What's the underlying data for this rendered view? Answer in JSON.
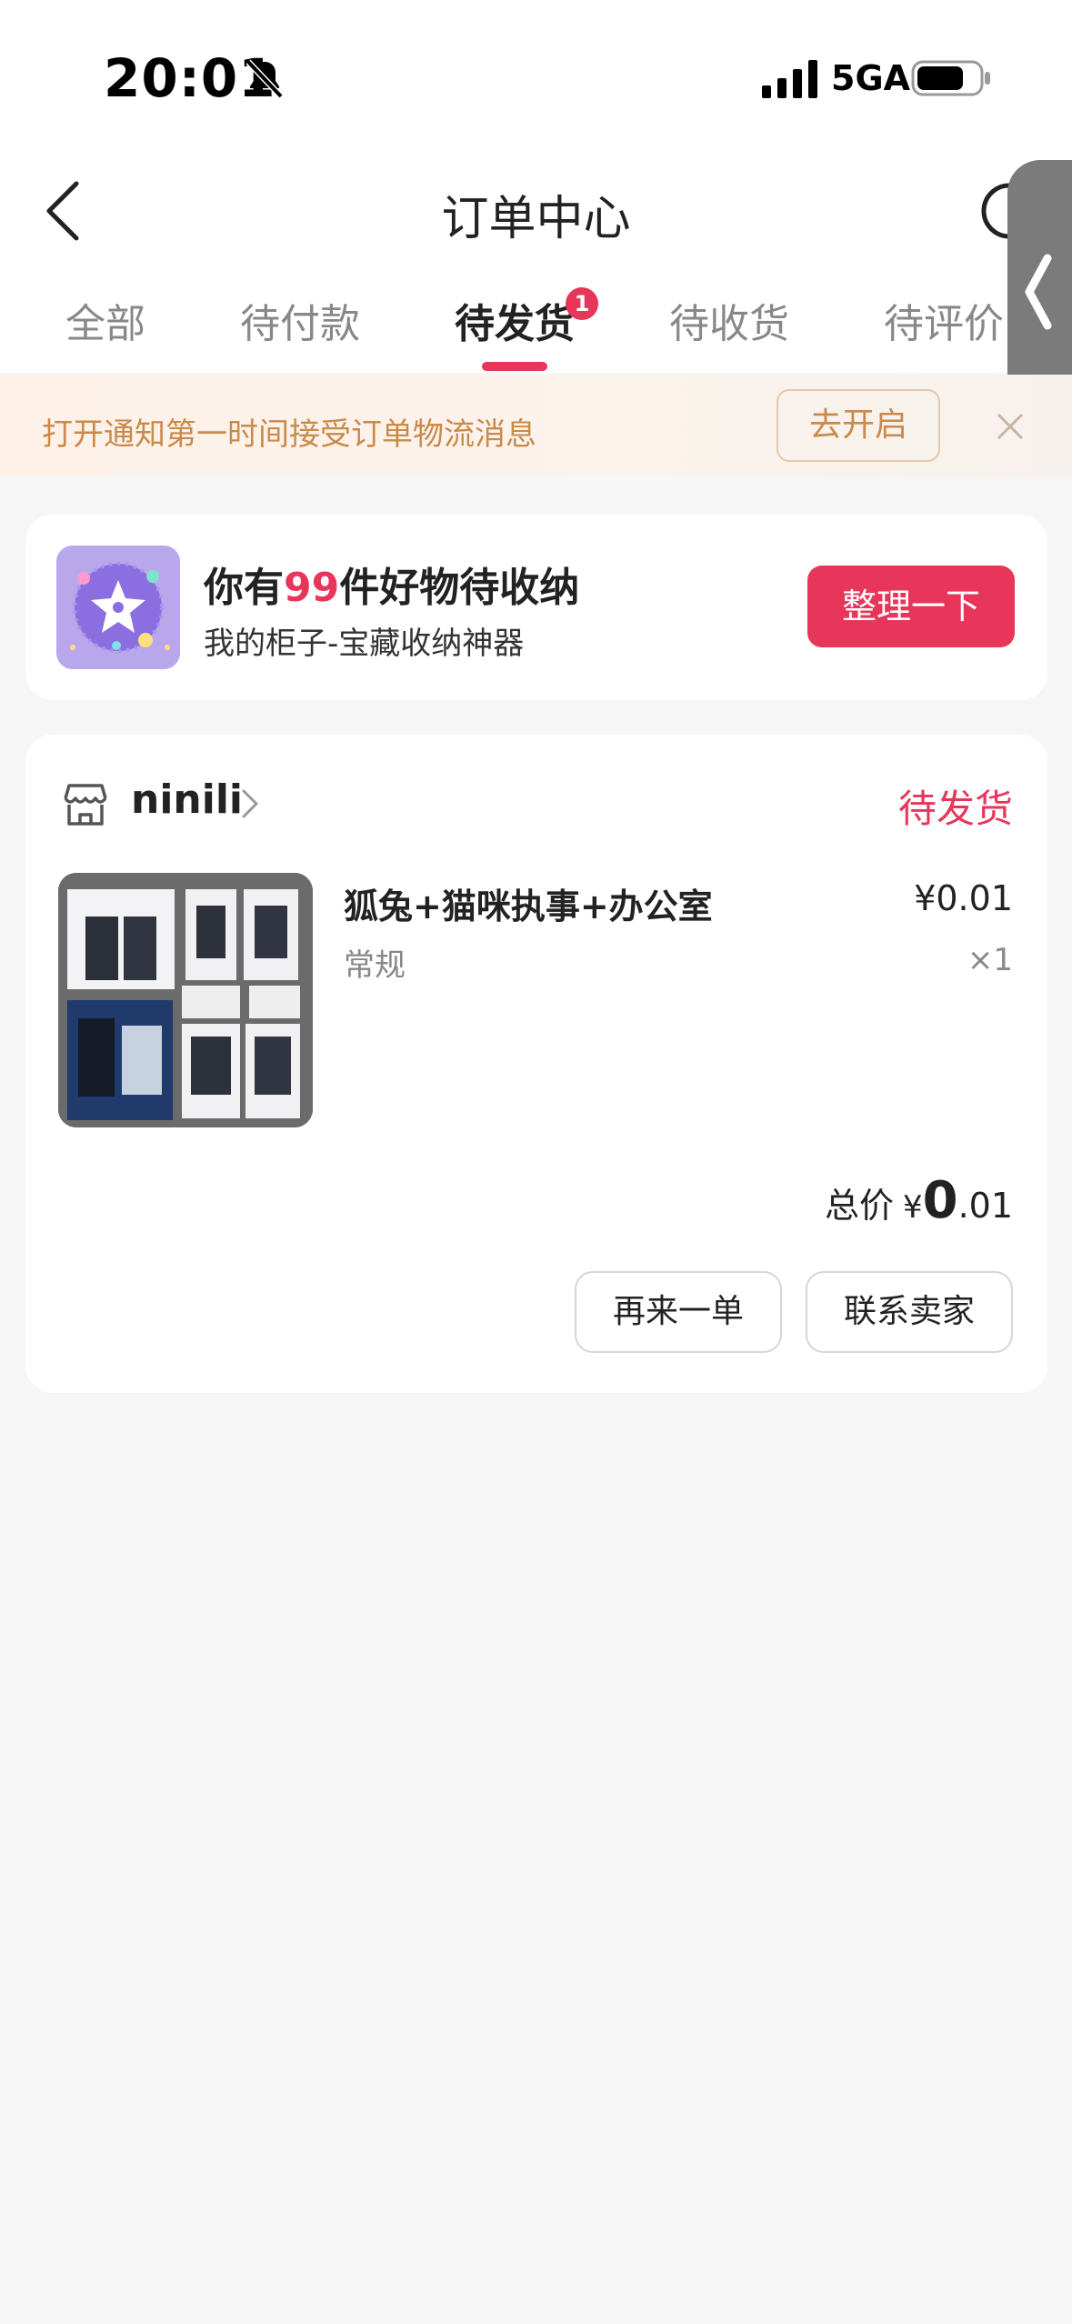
{
  "status_bar": {
    "time": "20:01",
    "network": "5GA",
    "icons": [
      "bell-off-icon",
      "signal-icon",
      "battery-icon"
    ]
  },
  "header": {
    "title": "订单中心",
    "tabs": [
      {
        "label": "全部",
        "active": false
      },
      {
        "label": "待付款",
        "active": false
      },
      {
        "label": "待发货",
        "active": true,
        "badge": "1"
      },
      {
        "label": "待收货",
        "active": false
      },
      {
        "label": "待评价",
        "active": false
      }
    ]
  },
  "notice": {
    "text": "打开通知第一时间接受订单物流消息",
    "button": "去开启"
  },
  "promo": {
    "title_prefix": "你有",
    "count": "99",
    "title_suffix": "件好物待收纳",
    "subtitle": "我的柜子-宝藏收纳神器",
    "button": "整理一下"
  },
  "order": {
    "shop_name": "ninili",
    "status": "待发货",
    "product": {
      "name": "狐兔+猫咪执事+办公室",
      "spec": "常规",
      "price": "¥0.01",
      "quantity": "×1"
    },
    "total": {
      "label": "总价",
      "currency": "¥",
      "integer": "0",
      "decimal": ".01"
    },
    "buttons": {
      "reorder": "再来一单",
      "contact": "联系卖家"
    }
  },
  "colors": {
    "accent": "#e8355a",
    "notice_text": "#c98a4a",
    "background": "#f6f6f6"
  }
}
